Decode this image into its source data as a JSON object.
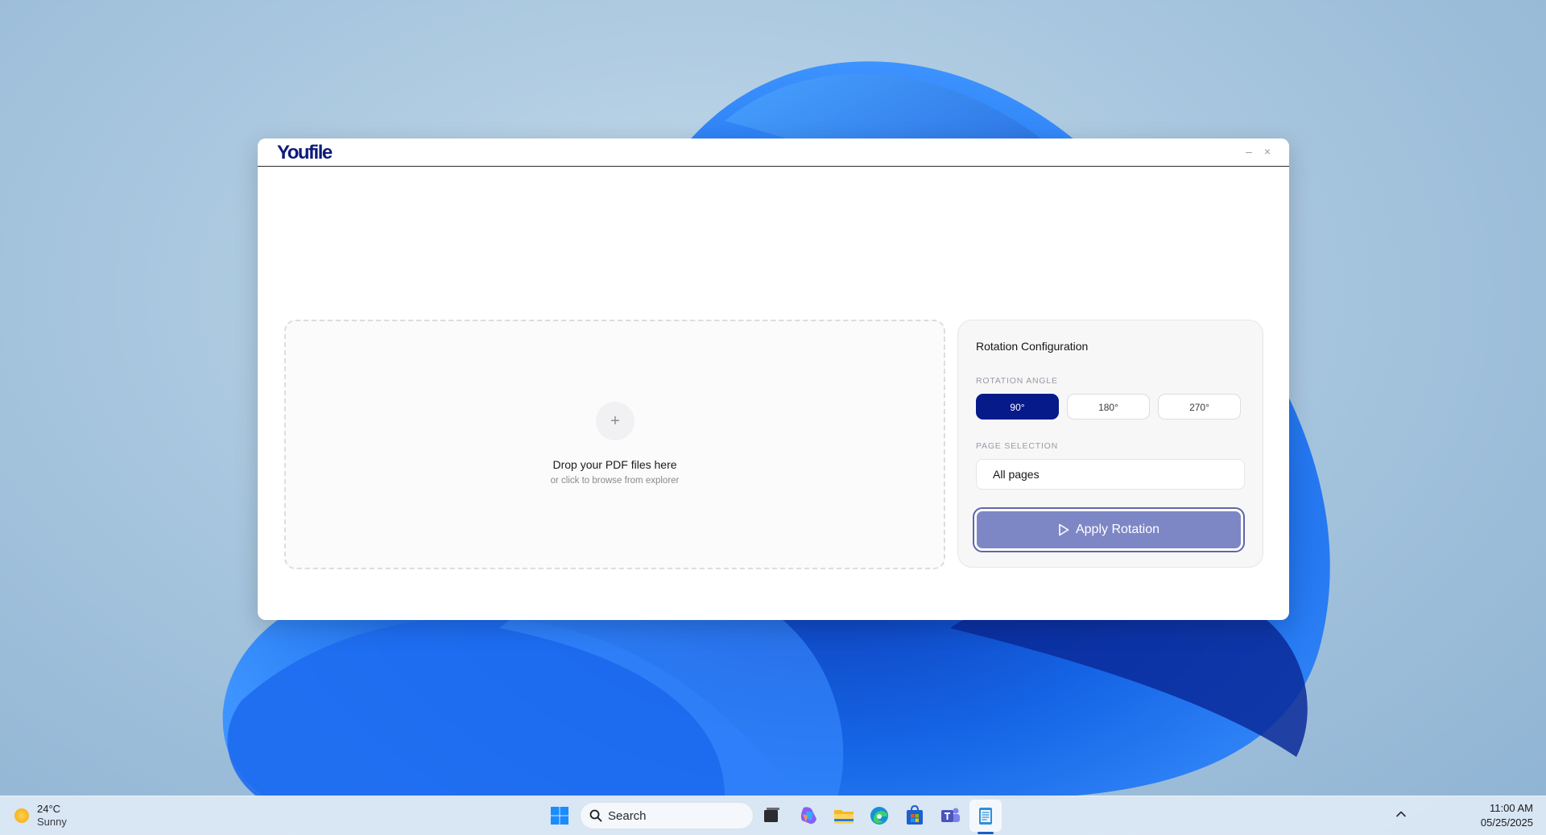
{
  "app": {
    "logo": "Youfile",
    "window_controls": {
      "minimize": "–",
      "close": "×"
    }
  },
  "dropzone": {
    "plus": "+",
    "title": "Drop your PDF files here",
    "subtitle": "or click to browse from explorer"
  },
  "config": {
    "title": "Rotation Configuration",
    "angle_label": "ROTATION ANGLE",
    "angles": [
      "90°",
      "180°",
      "270°"
    ],
    "selected_angle": "90°",
    "pages_label": "PAGE SELECTION",
    "pages_value": "All pages",
    "apply_label": "Apply Rotation"
  },
  "colors": {
    "accent": "#071a8a",
    "apply_button": "#7e87c5",
    "logo": "#0d1b7a"
  },
  "taskbar": {
    "weather_temp": "24°C",
    "weather_condition": "Sunny",
    "search_label": "Search",
    "time": "11:00 AM",
    "date": "05/25/2025",
    "icons": [
      "weather-sun-icon",
      "windows-start-icon",
      "search-icon",
      "task-view-icon",
      "copilot-icon",
      "file-explorer-icon",
      "edge-icon",
      "store-icon",
      "teams-icon",
      "notepad-icon",
      "tray-chevron-up-icon"
    ]
  }
}
